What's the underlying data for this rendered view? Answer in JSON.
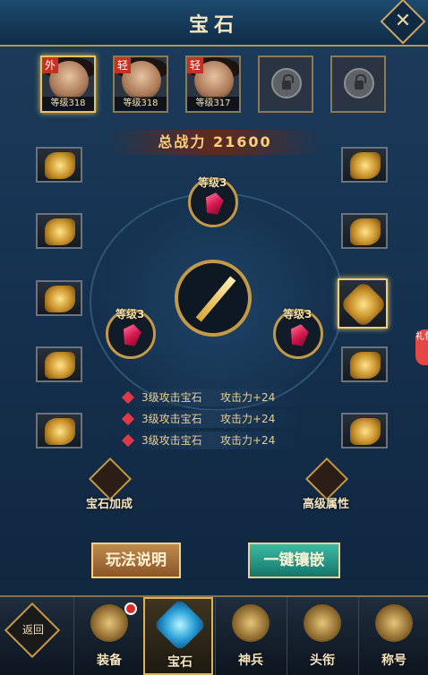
{
  "window": {
    "title": "宝石",
    "close_glyph": "✕"
  },
  "heroes": [
    {
      "tag": "外",
      "level": "等级318",
      "selected": true,
      "locked": false
    },
    {
      "tag": "轻",
      "level": "等级318",
      "selected": false,
      "locked": false
    },
    {
      "tag": "轻",
      "level": "等级317",
      "selected": false,
      "locked": false
    },
    {
      "locked": true
    },
    {
      "locked": true
    }
  ],
  "power": {
    "label": "总战力",
    "value": "21600"
  },
  "equip_left": [
    {
      "icon": "ring-icon"
    },
    {
      "icon": "necklace-icon"
    },
    {
      "icon": "bracer-icon"
    },
    {
      "icon": "amulet-icon"
    },
    {
      "icon": "belt-icon"
    }
  ],
  "equip_right": [
    {
      "icon": "ring-icon"
    },
    {
      "icon": "armor-icon"
    },
    {
      "icon": "sword-icon",
      "selected": true
    },
    {
      "icon": "robe-icon"
    },
    {
      "icon": "boots-icon"
    }
  ],
  "sockets": [
    {
      "label": "等级3"
    },
    {
      "label": "等级3"
    },
    {
      "label": "等级3"
    }
  ],
  "gem_stats": [
    {
      "name": "3级攻击宝石",
      "stat": "攻击力+24"
    },
    {
      "name": "3级攻击宝石",
      "stat": "攻击力+24"
    },
    {
      "name": "3级攻击宝石",
      "stat": "攻击力+24"
    }
  ],
  "features": {
    "gem_bonus": "宝石加成",
    "advanced_attr": "高级属性"
  },
  "buttons": {
    "rules": "玩法说明",
    "auto_inlay": "一键镶嵌"
  },
  "gift_badge": "礼包",
  "nav": {
    "back": "返回",
    "items": [
      {
        "label": "装备",
        "icon": "equipment-icon",
        "badge": true
      },
      {
        "label": "宝石",
        "icon": "gem-icon",
        "selected": true
      },
      {
        "label": "神兵",
        "icon": "divine-weapon-icon"
      },
      {
        "label": "头衔",
        "icon": "rank-title-icon"
      },
      {
        "label": "称号",
        "icon": "honor-title-icon"
      }
    ]
  },
  "colors": {
    "accent_gold": "#c59a47",
    "ruby": "#d3174e",
    "green_button": "#14766c",
    "brown_button": "#8a5628"
  }
}
